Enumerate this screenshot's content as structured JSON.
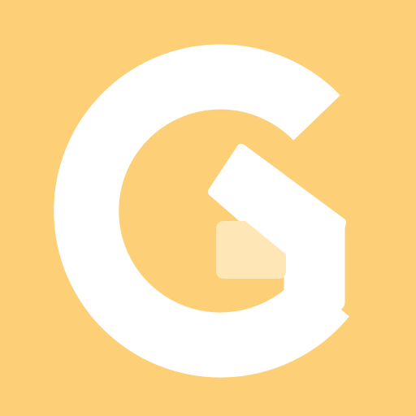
{
  "icon": {
    "name": "letter-g-logo-icon",
    "background_color": "#FDCF76",
    "glyph_color": "#FFFFFF",
    "inset_color": "#FFE6B7"
  }
}
